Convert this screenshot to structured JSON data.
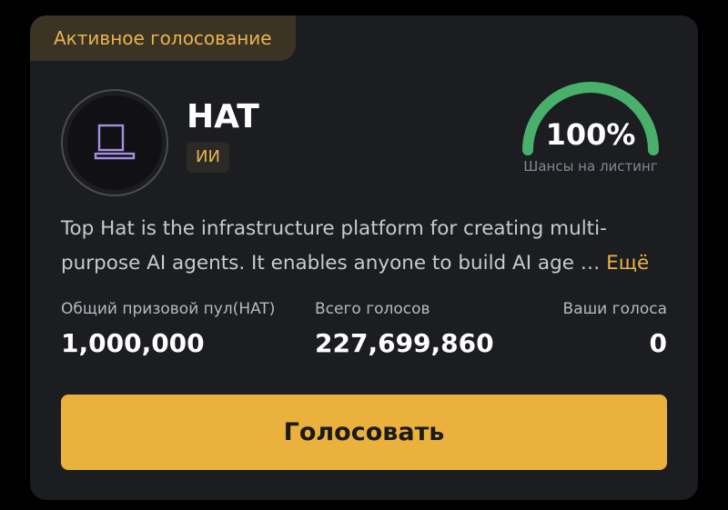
{
  "card": {
    "badge": "Активное голосование",
    "token": {
      "name": "HAT",
      "category": "ИИ",
      "logo_icon": "monitor-icon"
    },
    "listing_chance": {
      "value": "100%",
      "fraction": 1.0,
      "label": "Шансы на листинг",
      "color": "#49b06b"
    },
    "description": {
      "text": "Top Hat is the infrastructure platform for creating multi-purpose AI agents. It enables anyone to build AI age … ",
      "more_label": "Ещё"
    },
    "stats": {
      "prize_pool_label": "Общий призовой пул(HAT)",
      "prize_pool_value": "1,000,000",
      "total_votes_label": "Всего голосов",
      "total_votes_value": "227,699,860",
      "your_votes_label": "Ваши голоса",
      "your_votes_value": "0"
    },
    "vote_button_label": "Голосовать",
    "colors": {
      "accent": "#ebb13d",
      "background": "#1c1d21",
      "badge_bg": "#3b3324"
    }
  }
}
